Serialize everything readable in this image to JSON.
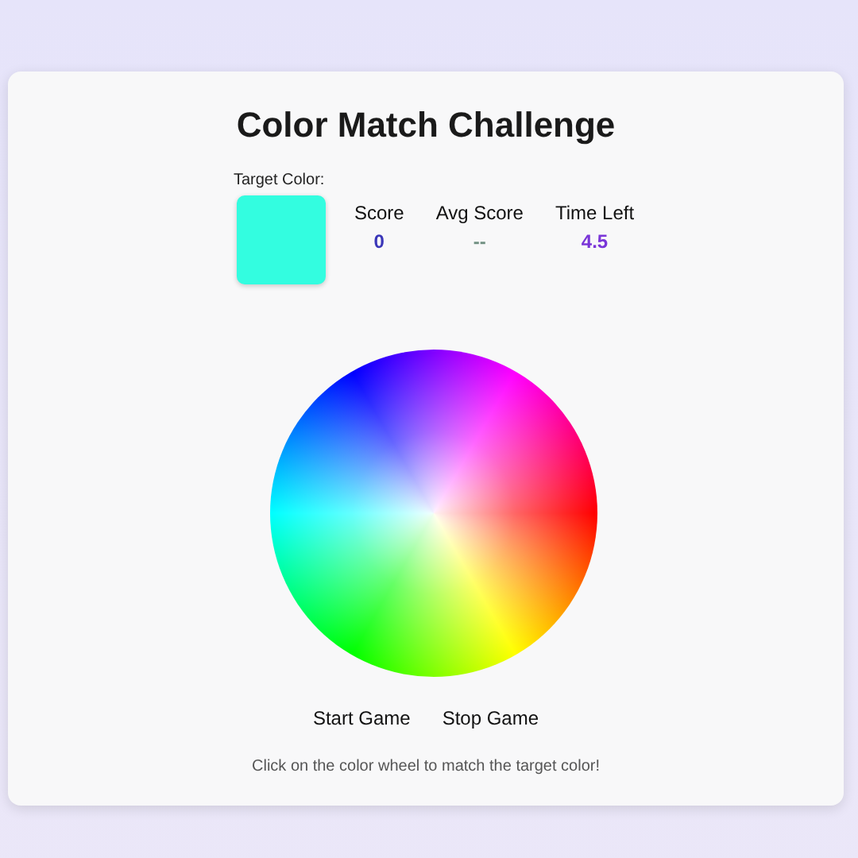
{
  "title": "Color Match Challenge",
  "target": {
    "label": "Target Color:",
    "color": "#33fde0"
  },
  "stats": [
    {
      "label": "Score",
      "value": "0",
      "color": "#3a36b8"
    },
    {
      "label": "Avg Score",
      "value": "--",
      "color": "#6f8f80"
    },
    {
      "label": "Time Left",
      "value": "4.5",
      "color": "#7a35d8"
    }
  ],
  "buttons": [
    "Start Game",
    "Stop Game"
  ],
  "hint": "Click on the color wheel to match the target color!"
}
